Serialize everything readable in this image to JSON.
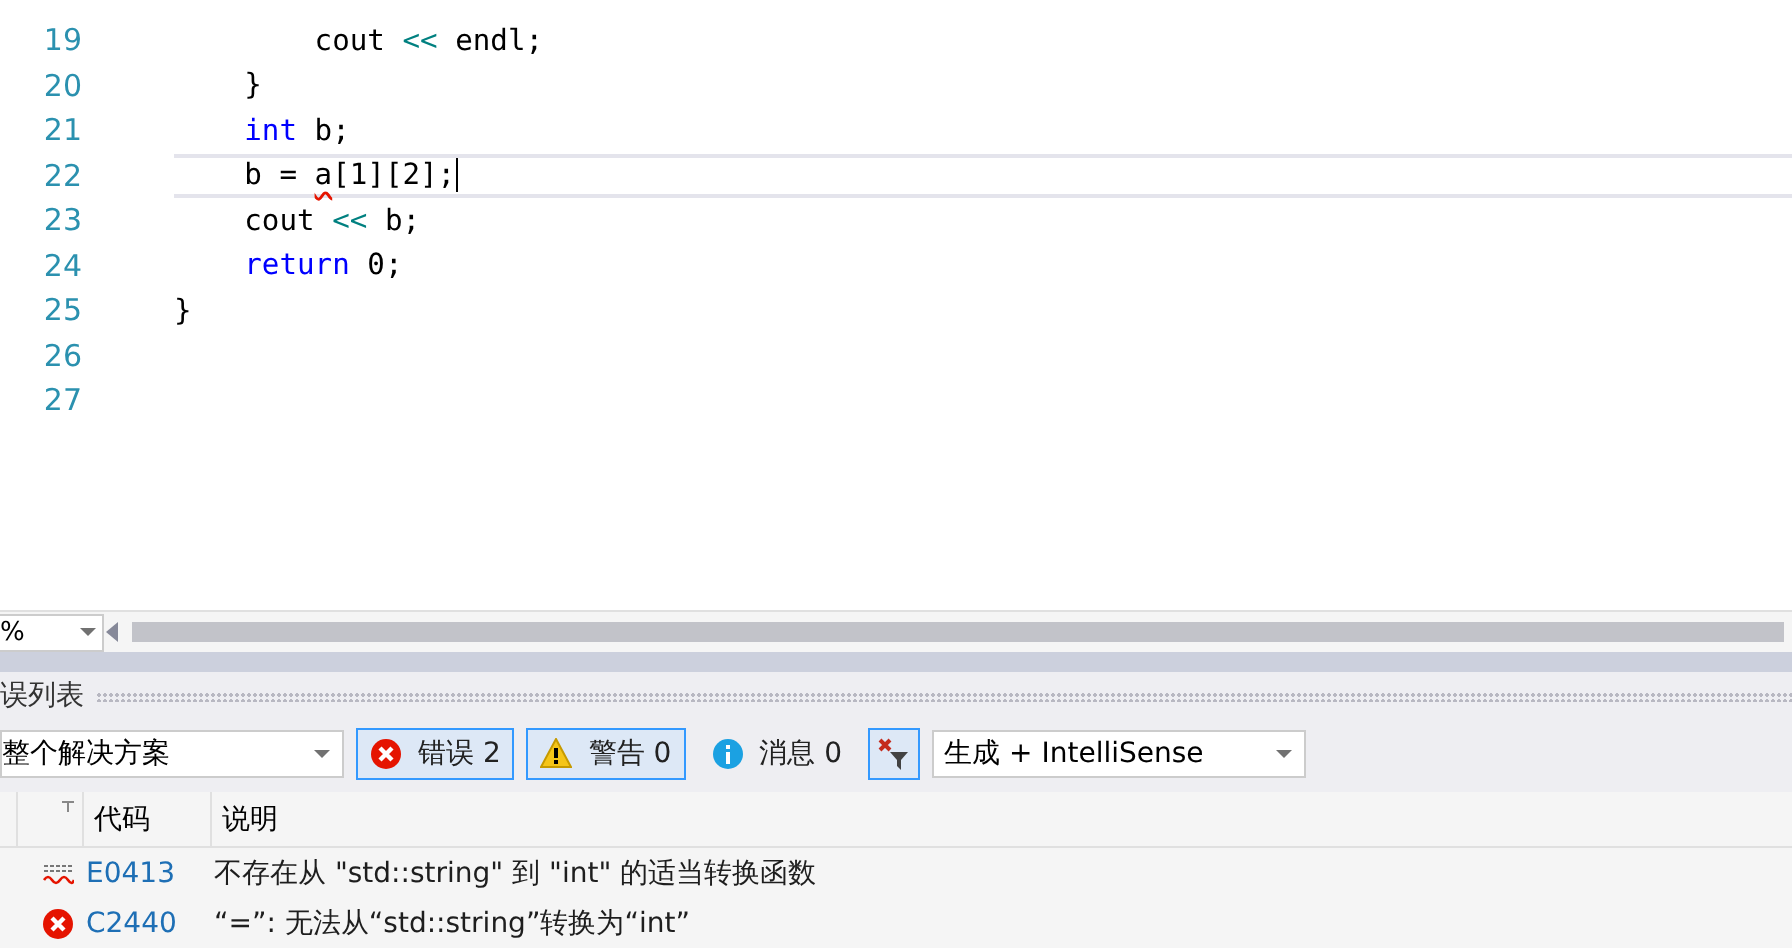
{
  "editor": {
    "lines": [
      {
        "number": "19",
        "current": false,
        "tokens": [
          {
            "kind": "plain",
            "text": "        cout "
          },
          {
            "kind": "operator",
            "text": "<<"
          },
          {
            "kind": "plain",
            "text": " endl;"
          }
        ]
      },
      {
        "number": "20",
        "current": false,
        "tokens": [
          {
            "kind": "plain",
            "text": "    }"
          }
        ]
      },
      {
        "number": "21",
        "current": false,
        "tokens": [
          {
            "kind": "keyword",
            "text": "    int"
          },
          {
            "kind": "plain",
            "text": " b;"
          }
        ]
      },
      {
        "number": "22",
        "current": true,
        "tokens": [
          {
            "kind": "plain",
            "text": "    b = "
          },
          {
            "kind": "error",
            "text": "a"
          },
          {
            "kind": "plain",
            "text": "[1][2];"
          }
        ]
      },
      {
        "number": "23",
        "current": false,
        "tokens": [
          {
            "kind": "plain",
            "text": "    cout "
          },
          {
            "kind": "operator",
            "text": "<<"
          },
          {
            "kind": "plain",
            "text": " b;"
          }
        ]
      },
      {
        "number": "24",
        "current": false,
        "tokens": [
          {
            "kind": "keyword",
            "text": "    return"
          },
          {
            "kind": "plain",
            "text": " 0;"
          }
        ]
      },
      {
        "number": "25",
        "current": false,
        "tokens": [
          {
            "kind": "plain",
            "text": "}"
          }
        ]
      },
      {
        "number": "26",
        "current": false
      },
      {
        "number": "27",
        "current": false
      }
    ],
    "zoom": "%"
  },
  "error_list": {
    "title": "误列表",
    "scope": "整个解决方案",
    "filters": [
      {
        "kind": "error",
        "label": "错误 2",
        "selected": true
      },
      {
        "kind": "warning",
        "label": "警告 0",
        "selected": true
      },
      {
        "kind": "info",
        "label": "消息 0",
        "selected": false
      }
    ],
    "clear_filter": {
      "selected": true
    },
    "source": "生成 + IntelliSense",
    "columns": [
      "代码",
      "说明"
    ],
    "rows": [
      {
        "kind": "intellisense",
        "code": "E0413",
        "description": "不存在从 \"std::string\" 到 \"int\" 的适当转换函数"
      },
      {
        "kind": "error",
        "code": "C2440",
        "description": "“=”: 无法从“std::string”转换为“int”"
      }
    ]
  }
}
